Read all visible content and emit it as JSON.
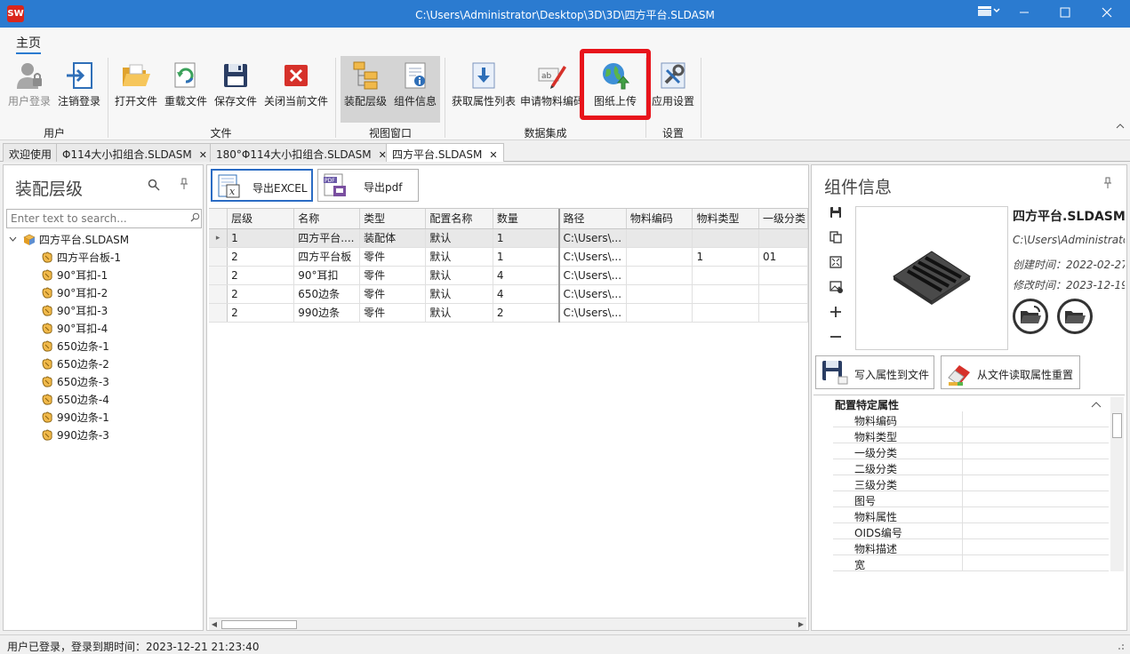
{
  "window": {
    "title": "C:\\Users\\Administrator\\Desktop\\3D\\3D\\四方平台.SLDASM",
    "logo_text": "SW"
  },
  "ribbon": {
    "tab": "主页",
    "groups": {
      "user": "用户",
      "file": "文件",
      "view": "视图窗口",
      "data": "数据集成",
      "settings": "设置"
    },
    "buttons": {
      "login": "用户登录",
      "logout": "注销登录",
      "open": "打开文件",
      "reload": "重载文件",
      "save": "保存文件",
      "close": "关闭当前文件",
      "assembly": "装配层级",
      "component": "组件信息",
      "getprops": "获取属性列表",
      "apply": "申请物料编码",
      "upload": "图纸上传",
      "appsettings": "应用设置"
    }
  },
  "doc_tabs": [
    "欢迎使用",
    "Φ114大小扣组合.SLDASM",
    "180°Φ114大小扣组合.SLDASM",
    "四方平台.SLDASM"
  ],
  "left": {
    "title": "装配层级",
    "search_placeholder": "Enter text to search...",
    "root": "四方平台.SLDASM",
    "items": [
      "四方平台板-1",
      "90°耳扣-1",
      "90°耳扣-2",
      "90°耳扣-3",
      "90°耳扣-4",
      "650边条-1",
      "650边条-2",
      "650边条-3",
      "650边条-4",
      "990边条-1",
      "990边条-3"
    ]
  },
  "center": {
    "export_excel": "导出EXCEL",
    "export_pdf": "导出pdf",
    "columns": [
      "层级",
      "名称",
      "类型",
      "配置名称",
      "数量",
      "路径",
      "物料编码",
      "物料类型",
      "一级分类"
    ],
    "rows": [
      [
        "1",
        "四方平台....",
        "装配体",
        "默认",
        "1",
        "C:\\Users\\...",
        "",
        "",
        ""
      ],
      [
        "2",
        "四方平台板",
        "零件",
        "默认",
        "1",
        "C:\\Users\\...",
        "",
        "1",
        "01"
      ],
      [
        "2",
        "90°耳扣",
        "零件",
        "默认",
        "4",
        "C:\\Users\\...",
        "",
        "",
        ""
      ],
      [
        "2",
        "650边条",
        "零件",
        "默认",
        "4",
        "C:\\Users\\...",
        "",
        "",
        ""
      ],
      [
        "2",
        "990边条",
        "零件",
        "默认",
        "2",
        "C:\\Users\\...",
        "",
        "",
        ""
      ]
    ]
  },
  "right": {
    "title": "组件信息",
    "name": "四方平台.SLDASM",
    "path": "C:\\Users\\Administrato",
    "created": "创建时间：2022-02-27",
    "modified": "修改时间：2023-12-19",
    "write_props": "写入属性到文件",
    "read_props": "从文件读取属性重置",
    "category": "配置特定属性",
    "props": [
      "物料编码",
      "物料类型",
      "一级分类",
      "二级分类",
      "三级分类",
      "图号",
      "物料属性",
      "OIDS编号",
      "物料描述",
      "宽"
    ]
  },
  "status": {
    "text": "用户已登录，登录到期时间：2023-12-21 21:23:40"
  }
}
